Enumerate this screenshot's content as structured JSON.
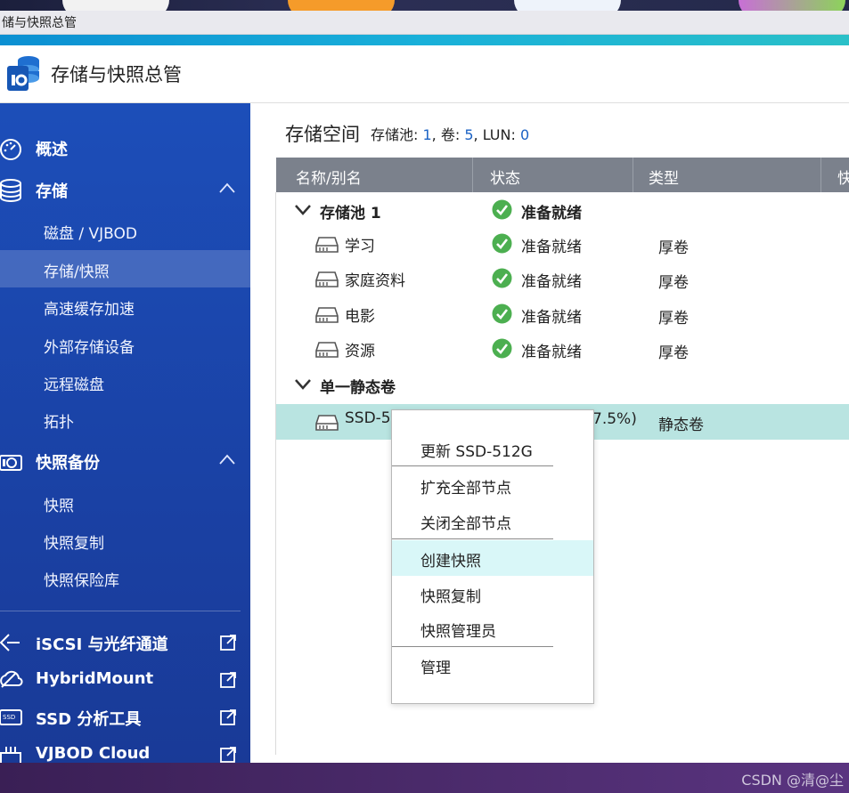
{
  "window": {
    "title": "储与快照总管"
  },
  "app": {
    "title": "存储与快照总管"
  },
  "sidebar": {
    "groups": [
      {
        "label": "概述",
        "icon": "gauge-icon"
      },
      {
        "label": "存储",
        "icon": "database-icon",
        "items": [
          "磁盘 / VJBOD",
          "存储/快照",
          "高速缓存加速",
          "外部存储设备",
          "远程磁盘",
          "拓扑"
        ]
      },
      {
        "label": "快照备份",
        "icon": "camera-icon",
        "items": [
          "快照",
          "快照复制",
          "快照保险库"
        ]
      }
    ],
    "active_item": "存储/快照",
    "external": [
      {
        "label": "iSCSI 与光纤通道",
        "icon": "iscsi-icon"
      },
      {
        "label": "HybridMount",
        "icon": "cloud-mount-icon"
      },
      {
        "label": "SSD 分析工具",
        "icon": "ssd-icon"
      },
      {
        "label": "VJBOD Cloud",
        "icon": "vjbod-cloud-icon"
      }
    ]
  },
  "main": {
    "title": "存储空间",
    "summary": {
      "pool_label": "存储池: ",
      "pool_count": "1",
      "vol_label": ", 卷: ",
      "vol_count": "5",
      "lun_label": ", LUN: ",
      "lun_count": "0"
    },
    "columns": [
      "名称/别名",
      "状态",
      "类型",
      "快"
    ],
    "groups": [
      {
        "name": "存储池 1",
        "status": "准备就绪",
        "volumes": [
          {
            "name": "学习",
            "status": "准备就绪",
            "type": "厚卷"
          },
          {
            "name": "家庭资料",
            "status": "准备就绪",
            "type": "厚卷"
          },
          {
            "name": "电影",
            "status": "准备就绪",
            "type": "厚卷"
          },
          {
            "name": "资源",
            "status": "准备就绪",
            "type": "厚卷"
          }
        ]
      },
      {
        "name": "单一静态卷",
        "volumes": [
          {
            "name": "SSD-5",
            "status": "7.5%)",
            "type": "静态卷",
            "selected": true
          }
        ]
      }
    ]
  },
  "context_menu": {
    "items": [
      "更新 SSD-512G",
      "扩充全部节点",
      "关闭全部节点",
      "创建快照",
      "快照复制",
      "快照管理员",
      "管理"
    ],
    "hovered": "创建快照"
  },
  "watermark": "CSDN @清@尘",
  "colors": {
    "sidebar": "#1c4eb9",
    "header": "#7b818c",
    "selected_row": "#b9e4e1",
    "ok_green": "#4caf50",
    "accent": "#1b62c4"
  }
}
